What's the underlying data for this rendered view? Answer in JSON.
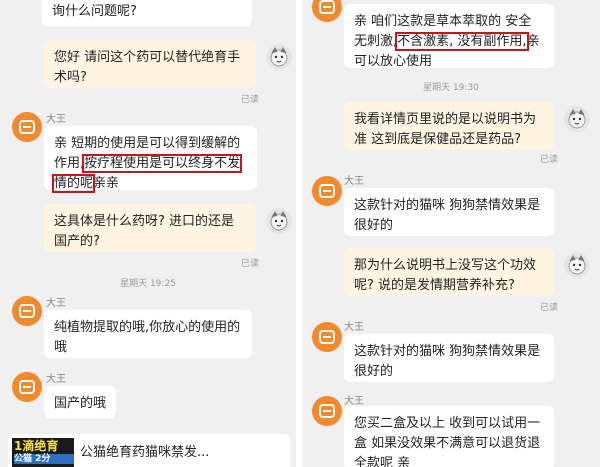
{
  "left": {
    "top_bubble": "询什么问题呢?",
    "q1": "您好 请问这个药可以替代绝育手术吗?",
    "q1_read": "已读",
    "sender1": "大王",
    "a1_part1": "亲 短期的使用是可以得到缓解的作用,",
    "a1_hl1": "按疗程使用是可以终身不发",
    "a1_hl2": "情的呢",
    "a1_end": "亲亲",
    "q2": "这具体是什么药呀? 进口的还是国产的?",
    "q2_read": "已读",
    "time1": "星期天 19:25",
    "sender2": "大王",
    "a2": "纯植物提取的哦,你放心的使用的哦",
    "sender3": "大王",
    "a3": "国产的哦",
    "product_title": "公猫绝育药猫咪禁发...",
    "product_thumb_main": "1滴绝育",
    "product_thumb_sub": "公猫 2分"
  },
  "right": {
    "a1_part1": "亲 咱们这款是草本萃取的 安全无刺激,",
    "a1_hl": "不含激素, 没有副作用,",
    "a1_end": "亲可以放心使用",
    "time1": "星期天 19:30",
    "q1": "我看详情页里说的是以说明书为准 这到底是保健品还是药品?",
    "q1_read": "已读",
    "sender1": "大王",
    "a2": "这款针对的猫咪 狗狗禁情效果是很好的",
    "q2": "那为什么说明书上没写这个功效呢? 说的是发情期营养补充?",
    "q2_read": "已读",
    "sender2": "大王",
    "a3": "这款针对的猫咪 狗狗禁情效果是很好的",
    "sender3": "大王",
    "a4": "您买二盒及以上 收到可以试用一盒 如果没效果不满意可以退货退全款呢 亲"
  },
  "colors": {
    "shop_avatar": "#f08a2c",
    "user_bubble": "#fdf5e2",
    "highlight_box": "#c4161c"
  }
}
